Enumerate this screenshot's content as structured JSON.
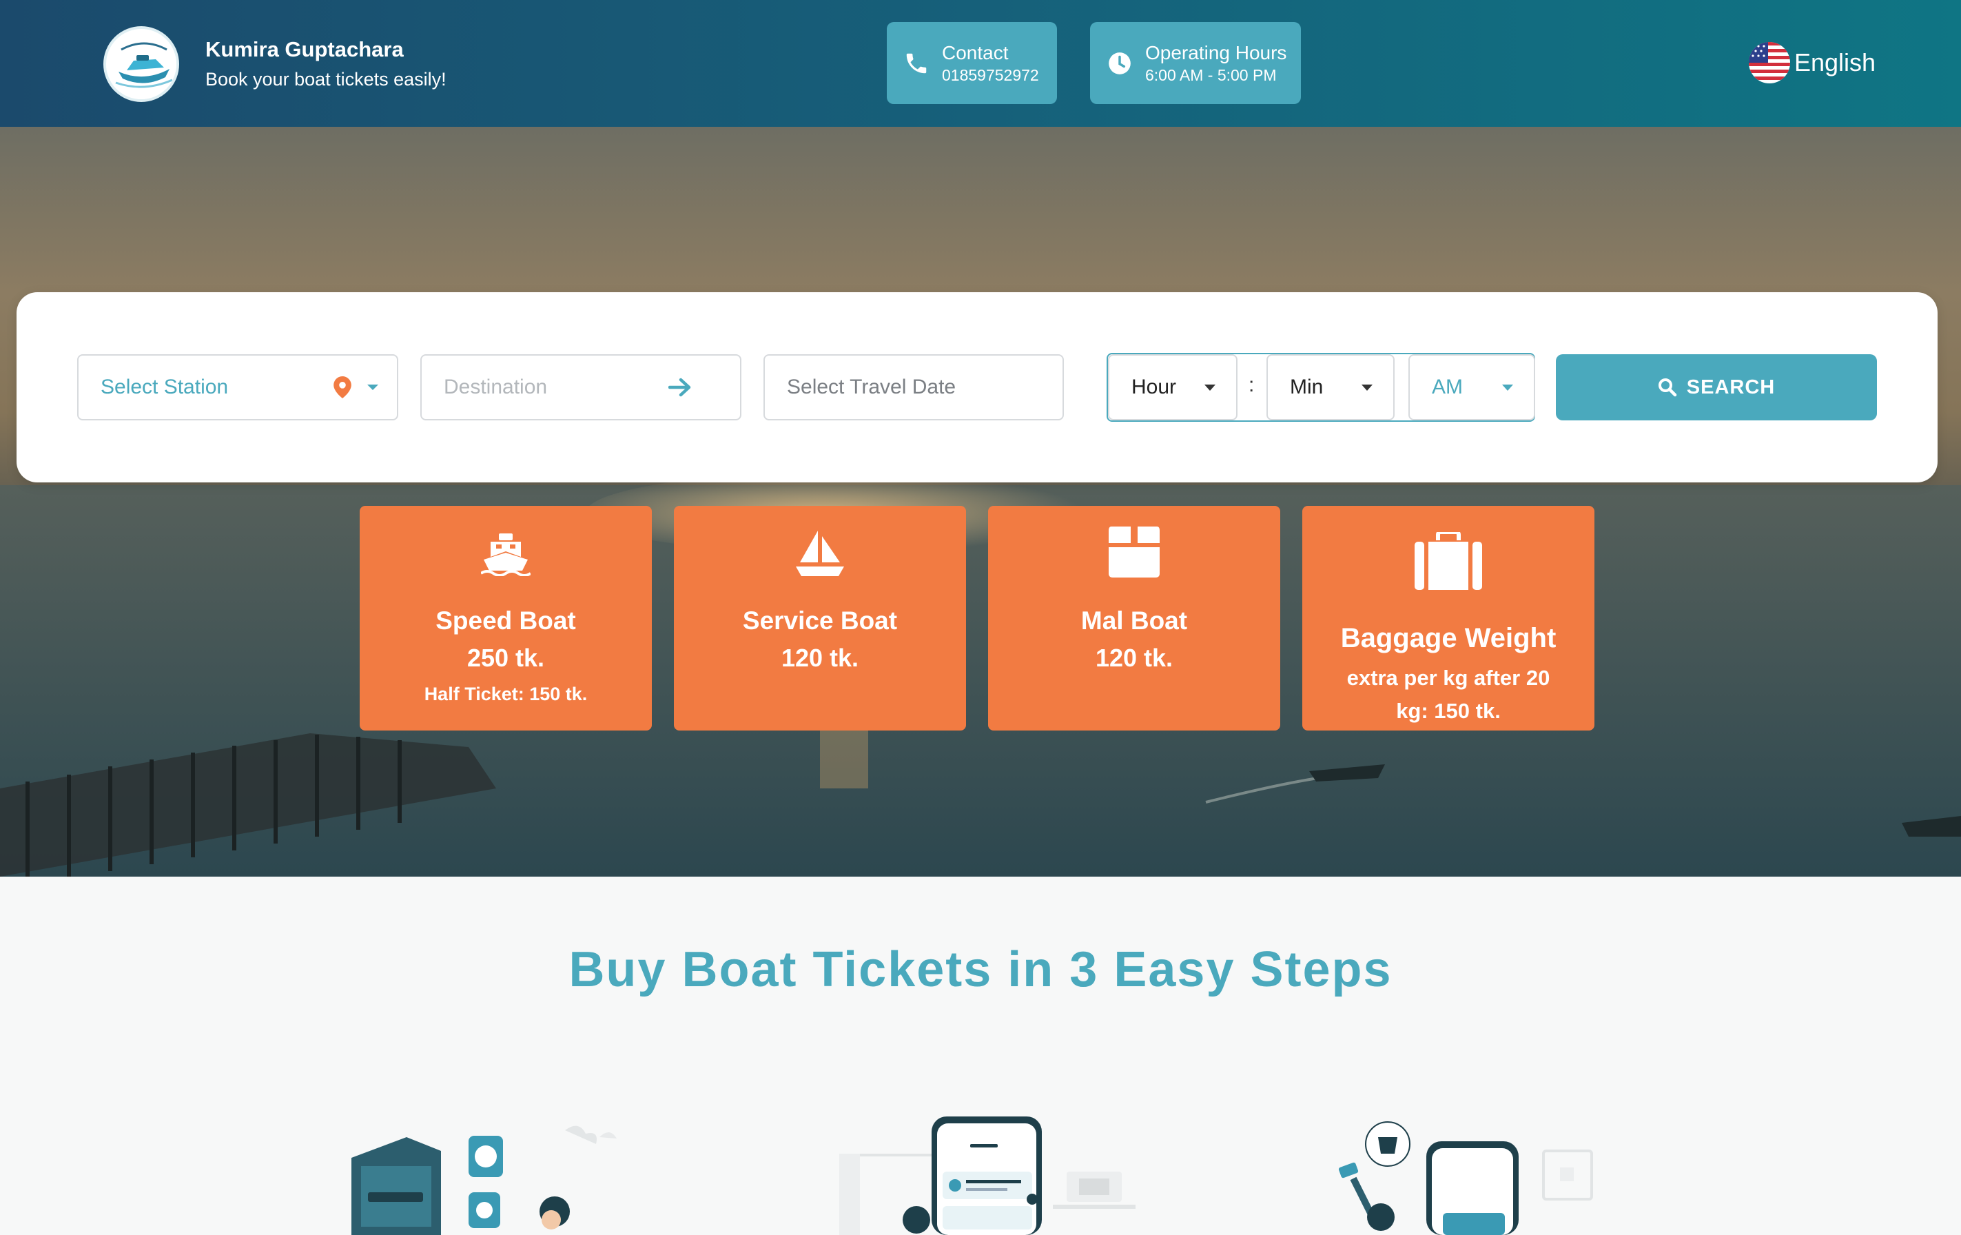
{
  "header": {
    "brand_title": "Kumira Guptachara",
    "brand_subtitle": "Book your boat tickets easily!",
    "contact": {
      "label": "Contact",
      "value": "01859752972"
    },
    "hours": {
      "label": "Operating Hours",
      "value": "6:00 AM - 5:00 PM"
    },
    "language": "English"
  },
  "search": {
    "station_placeholder": "Select Station",
    "destination_placeholder": "Destination",
    "date_placeholder": "Select Travel Date",
    "hour": "Hour",
    "separator": ":",
    "minute": "Min",
    "ampm": "AM",
    "button_label": "SEARCH"
  },
  "fares": [
    {
      "name": "Speed Boat",
      "price": "250 tk.",
      "note": "Half Ticket: 150 tk."
    },
    {
      "name": "Service Boat",
      "price": "120 tk."
    },
    {
      "name": "Mal Boat",
      "price": "120 tk."
    },
    {
      "name": "Baggage Weight",
      "note": "extra per kg after 20 kg: 150 tk."
    }
  ],
  "steps": {
    "title": "Buy Boat Tickets in 3 Easy Steps"
  },
  "colors": {
    "header_start": "#1b4a6c",
    "header_end": "#0f7584",
    "accent": "#4aa9bd",
    "card": "#f27b42"
  }
}
